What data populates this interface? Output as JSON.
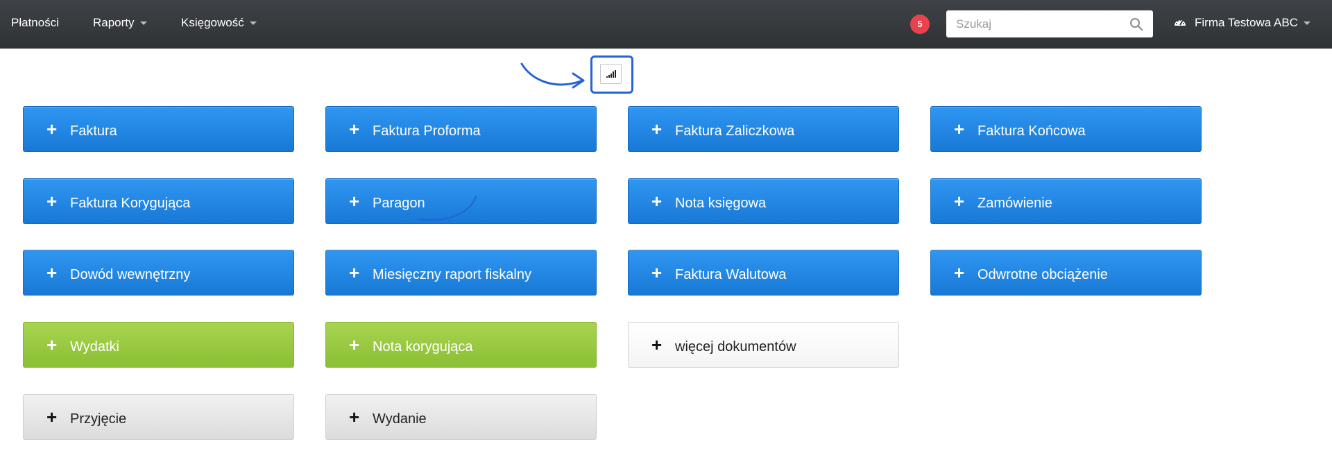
{
  "navbar": {
    "items": [
      {
        "label": "Płatności",
        "dropdown": false
      },
      {
        "label": "Raporty",
        "dropdown": true
      },
      {
        "label": "Księgowość",
        "dropdown": true
      }
    ],
    "notification_count": "5",
    "search": {
      "placeholder": "Szukaj",
      "value": ""
    },
    "company": {
      "label": "Firma Testowa ABC",
      "icon": "dashboard-icon"
    }
  },
  "toolbar": {
    "icon": "signal-bars-icon",
    "highlighted": true
  },
  "documents": {
    "plus_glyph": "+",
    "buttons": [
      {
        "label": "Faktura",
        "style": "blue"
      },
      {
        "label": "Faktura Proforma",
        "style": "blue"
      },
      {
        "label": "Faktura Zaliczkowa",
        "style": "blue"
      },
      {
        "label": "Faktura Końcowa",
        "style": "blue"
      },
      {
        "label": "Faktura Korygująca",
        "style": "blue"
      },
      {
        "label": "Paragon",
        "style": "blue"
      },
      {
        "label": "Nota księgowa",
        "style": "blue"
      },
      {
        "label": "Zamówienie",
        "style": "blue"
      },
      {
        "label": "Dowód wewnętrzny",
        "style": "blue"
      },
      {
        "label": "Miesięczny raport fiskalny",
        "style": "blue"
      },
      {
        "label": "Faktura Walutowa",
        "style": "blue"
      },
      {
        "label": "Odwrotne obciążenie",
        "style": "blue"
      },
      {
        "label": "Wydatki",
        "style": "green"
      },
      {
        "label": "Nota korygująca",
        "style": "green"
      },
      {
        "label": "więcej dokumentów",
        "style": "white"
      },
      {
        "label": "Przyjęcie",
        "style": "gray"
      },
      {
        "label": "Wydanie",
        "style": "gray"
      }
    ]
  },
  "colors": {
    "navbar": "#34373a",
    "primary": "#1f86e5",
    "success": "#9ccb45",
    "badge": "#e8434c",
    "annotation": "#2563d8"
  }
}
